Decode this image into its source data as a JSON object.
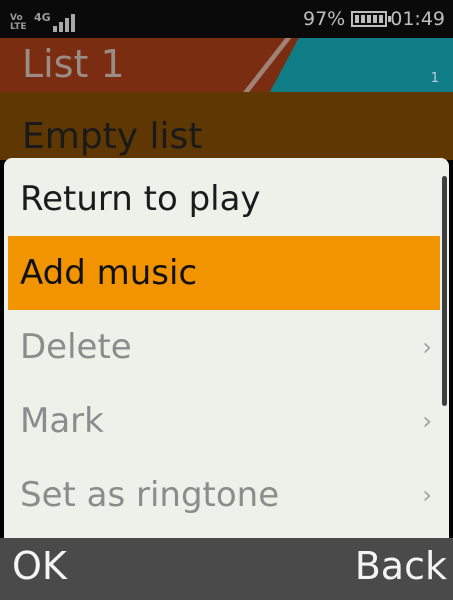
{
  "status_bar": {
    "volte": "Vo LTE",
    "network": "4G",
    "battery_percent": "97%",
    "battery_level": 0.97,
    "time": "01:49"
  },
  "header": {
    "title": "List 1",
    "count": "1"
  },
  "content": {
    "empty_text": "Empty list"
  },
  "menu": {
    "items": [
      {
        "label": "Return to play",
        "state": "normal",
        "has_arrow": false
      },
      {
        "label": "Add music",
        "state": "selected",
        "has_arrow": false
      },
      {
        "label": "Delete",
        "state": "disabled",
        "has_arrow": true
      },
      {
        "label": "Mark",
        "state": "disabled",
        "has_arrow": true
      },
      {
        "label": "Set as ringtone",
        "state": "disabled",
        "has_arrow": true
      }
    ],
    "arrow_glyph": "›"
  },
  "softkeys": {
    "left": "OK",
    "right": "Back"
  },
  "colors": {
    "selected": "#f29400",
    "header_left": "#7b2d12",
    "header_right": "#0f7d86",
    "softkey_bar": "#4a4a4a",
    "menu_bg": "#eef0ea"
  }
}
